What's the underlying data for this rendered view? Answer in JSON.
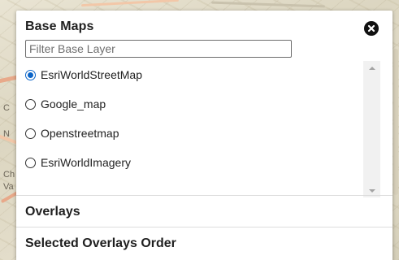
{
  "map": {
    "edge_labels": [
      "C",
      "N",
      "Ch",
      "Va"
    ]
  },
  "base_maps": {
    "title": "Base Maps",
    "filter_placeholder": "Filter Base Layer",
    "selected": "EsriWorldStreetMap",
    "layers": [
      {
        "label": "EsriWorldStreetMap",
        "checked": true
      },
      {
        "label": "Google_map",
        "checked": false
      },
      {
        "label": "Openstreetmap",
        "checked": false
      },
      {
        "label": "EsriWorldImagery",
        "checked": false
      }
    ]
  },
  "overlays": {
    "title": "Overlays"
  },
  "overlay_order": {
    "title": "Selected Overlays Order"
  },
  "colors": {
    "radio_accent": "#0a64c8",
    "close_button": "#111111",
    "panel_background": "#ffffff"
  },
  "icons": {
    "close": "close-icon",
    "scroll_up": "scroll-up-arrow",
    "scroll_down": "scroll-down-arrow"
  }
}
